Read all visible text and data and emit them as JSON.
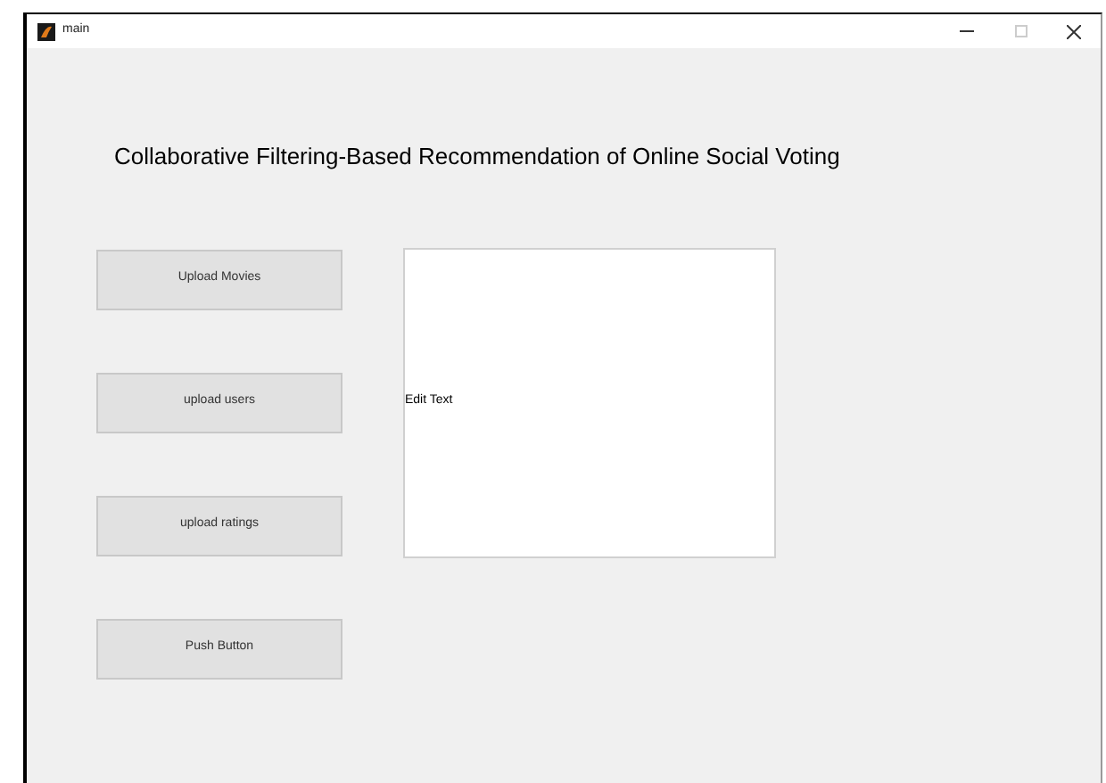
{
  "window": {
    "title": "main"
  },
  "heading": "Collaborative Filtering-Based Recommendation of Online Social Voting",
  "buttons": [
    "Upload Movies",
    "upload users",
    "upload ratings",
    "Push Button"
  ],
  "edit_text": {
    "value": "Edit Text"
  }
}
